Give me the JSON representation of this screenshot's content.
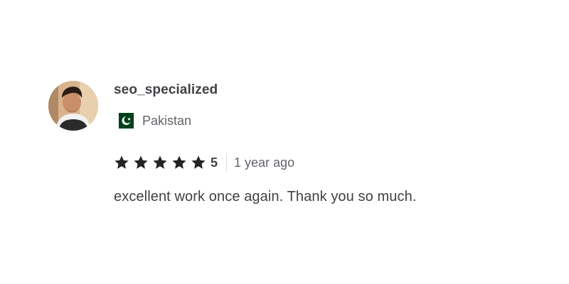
{
  "review": {
    "reviewer": {
      "username": "seo_specialized",
      "country": "Pakistan",
      "country_flag_icon": "pakistan-flag-icon",
      "avatar_icon": "user-avatar-photo"
    },
    "rating": {
      "value": "5",
      "stars_filled": 5,
      "stars_total": 5,
      "star_color": "#222325"
    },
    "time_ago": "1 year ago",
    "text": "excellent work once again. Thank you so much."
  },
  "colors": {
    "text_primary": "#404145",
    "text_secondary": "#62646a",
    "divider": "#dadbdd",
    "flag_green": "#01411c",
    "background": "#ffffff"
  }
}
